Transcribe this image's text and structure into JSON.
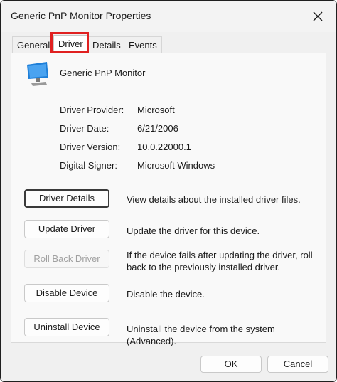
{
  "window": {
    "title": "Generic PnP Monitor Properties",
    "close_label": "Close"
  },
  "tabs": [
    {
      "label": "General"
    },
    {
      "label": "Driver",
      "selected": true
    },
    {
      "label": "Details"
    },
    {
      "label": "Events"
    }
  ],
  "device": {
    "name": "Generic PnP Monitor",
    "icon": "monitor-icon"
  },
  "info": [
    {
      "label": "Driver Provider:",
      "value": "Microsoft"
    },
    {
      "label": "Driver Date:",
      "value": "6/21/2006"
    },
    {
      "label": "Driver Version:",
      "value": "10.0.22000.1"
    },
    {
      "label": "Digital Signer:",
      "value": "Microsoft Windows"
    }
  ],
  "actions": [
    {
      "label": "Driver Details",
      "description": "View details about the installed driver files.",
      "enabled": true,
      "default": true
    },
    {
      "label": "Update Driver",
      "description": "Update the driver for this device.",
      "enabled": true
    },
    {
      "label": "Roll Back Driver",
      "description": "If the device fails after updating the driver, roll back to the previously installed driver.",
      "enabled": false
    },
    {
      "label": "Disable Device",
      "description": "Disable the device.",
      "enabled": true
    },
    {
      "label": "Uninstall Device",
      "description": "Uninstall the device from the system (Advanced).",
      "enabled": true
    }
  ],
  "footer": {
    "ok_label": "OK",
    "cancel_label": "Cancel"
  },
  "colors": {
    "highlight": "#e02020",
    "monitor_blue": "#1e7fd8"
  }
}
